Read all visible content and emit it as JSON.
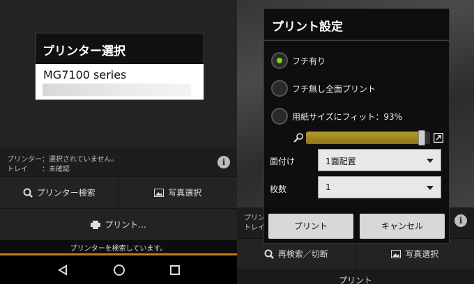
{
  "left": {
    "select_dialog": {
      "title": "プリンター選択",
      "printer_name": "MG7100 series"
    },
    "status": {
      "printer_label": "プリンター：選択されていません。",
      "tray_label": "トレイ　　：未確認"
    },
    "buttons": {
      "printer_search": "プリンター検索",
      "photo_select": "写真選択",
      "print": "プリント..."
    },
    "progress_text": "プリンターを検索しています。"
  },
  "right": {
    "dialog": {
      "title": "プリント設定",
      "options": [
        {
          "label": "フチ有り",
          "selected": true
        },
        {
          "label": "フチ無し全面プリント",
          "selected": false
        },
        {
          "label": "用紙サイズにフィット：93%",
          "selected": false
        }
      ],
      "fit_percent": 93,
      "layout_label": "面付け",
      "layout_value": "1面配置",
      "copies_label": "枚数",
      "copies_value": "1",
      "print_button": "プリント",
      "cancel_button": "キャンセル"
    },
    "status_partial": {
      "line1": "プリン",
      "line2": "トレイ"
    },
    "buttons": {
      "research": "再検索／切断",
      "photo_select": "写真選択",
      "print": "プリント"
    }
  },
  "colors": {
    "accent": "#c87a18",
    "radio_on": "#7ed321",
    "slider": "#a88d25"
  }
}
